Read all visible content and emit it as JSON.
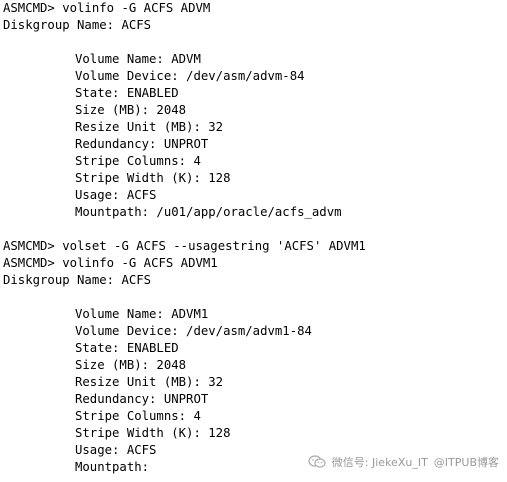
{
  "terminal": {
    "lines": [
      "ASMCMD> volinfo -G ACFS ADVM",
      "Diskgroup Name: ACFS",
      "",
      "Volume Name: ADVM",
      "Volume Device: /dev/asm/advm-84",
      "State: ENABLED",
      "Size (MB): 2048",
      "Resize Unit (MB): 32",
      "Redundancy: UNPROT",
      "Stripe Columns: 4",
      "Stripe Width (K): 128",
      "Usage: ACFS",
      "Mountpath: /u01/app/oracle/acfs_advm",
      "",
      "ASMCMD> volset -G ACFS --usagestring 'ACFS' ADVM1",
      "ASMCMD> volinfo -G ACFS ADVM1",
      "Diskgroup Name: ACFS",
      "",
      "Volume Name: ADVM1",
      "Volume Device: /dev/asm/advm1-84",
      "State: ENABLED",
      "Size (MB): 2048",
      "Resize Unit (MB): 32",
      "Redundancy: UNPROT",
      "Stripe Columns: 4",
      "Stripe Width (K): 128",
      "Usage: ACFS",
      "Mountpath:"
    ]
  },
  "watermark": {
    "text": "微信号: JiekeXu_IT",
    "icon": "wechat-icon",
    "overlay": "@ITPUB博客"
  },
  "colors": {
    "background": "#ffffff",
    "text": "#000000"
  }
}
